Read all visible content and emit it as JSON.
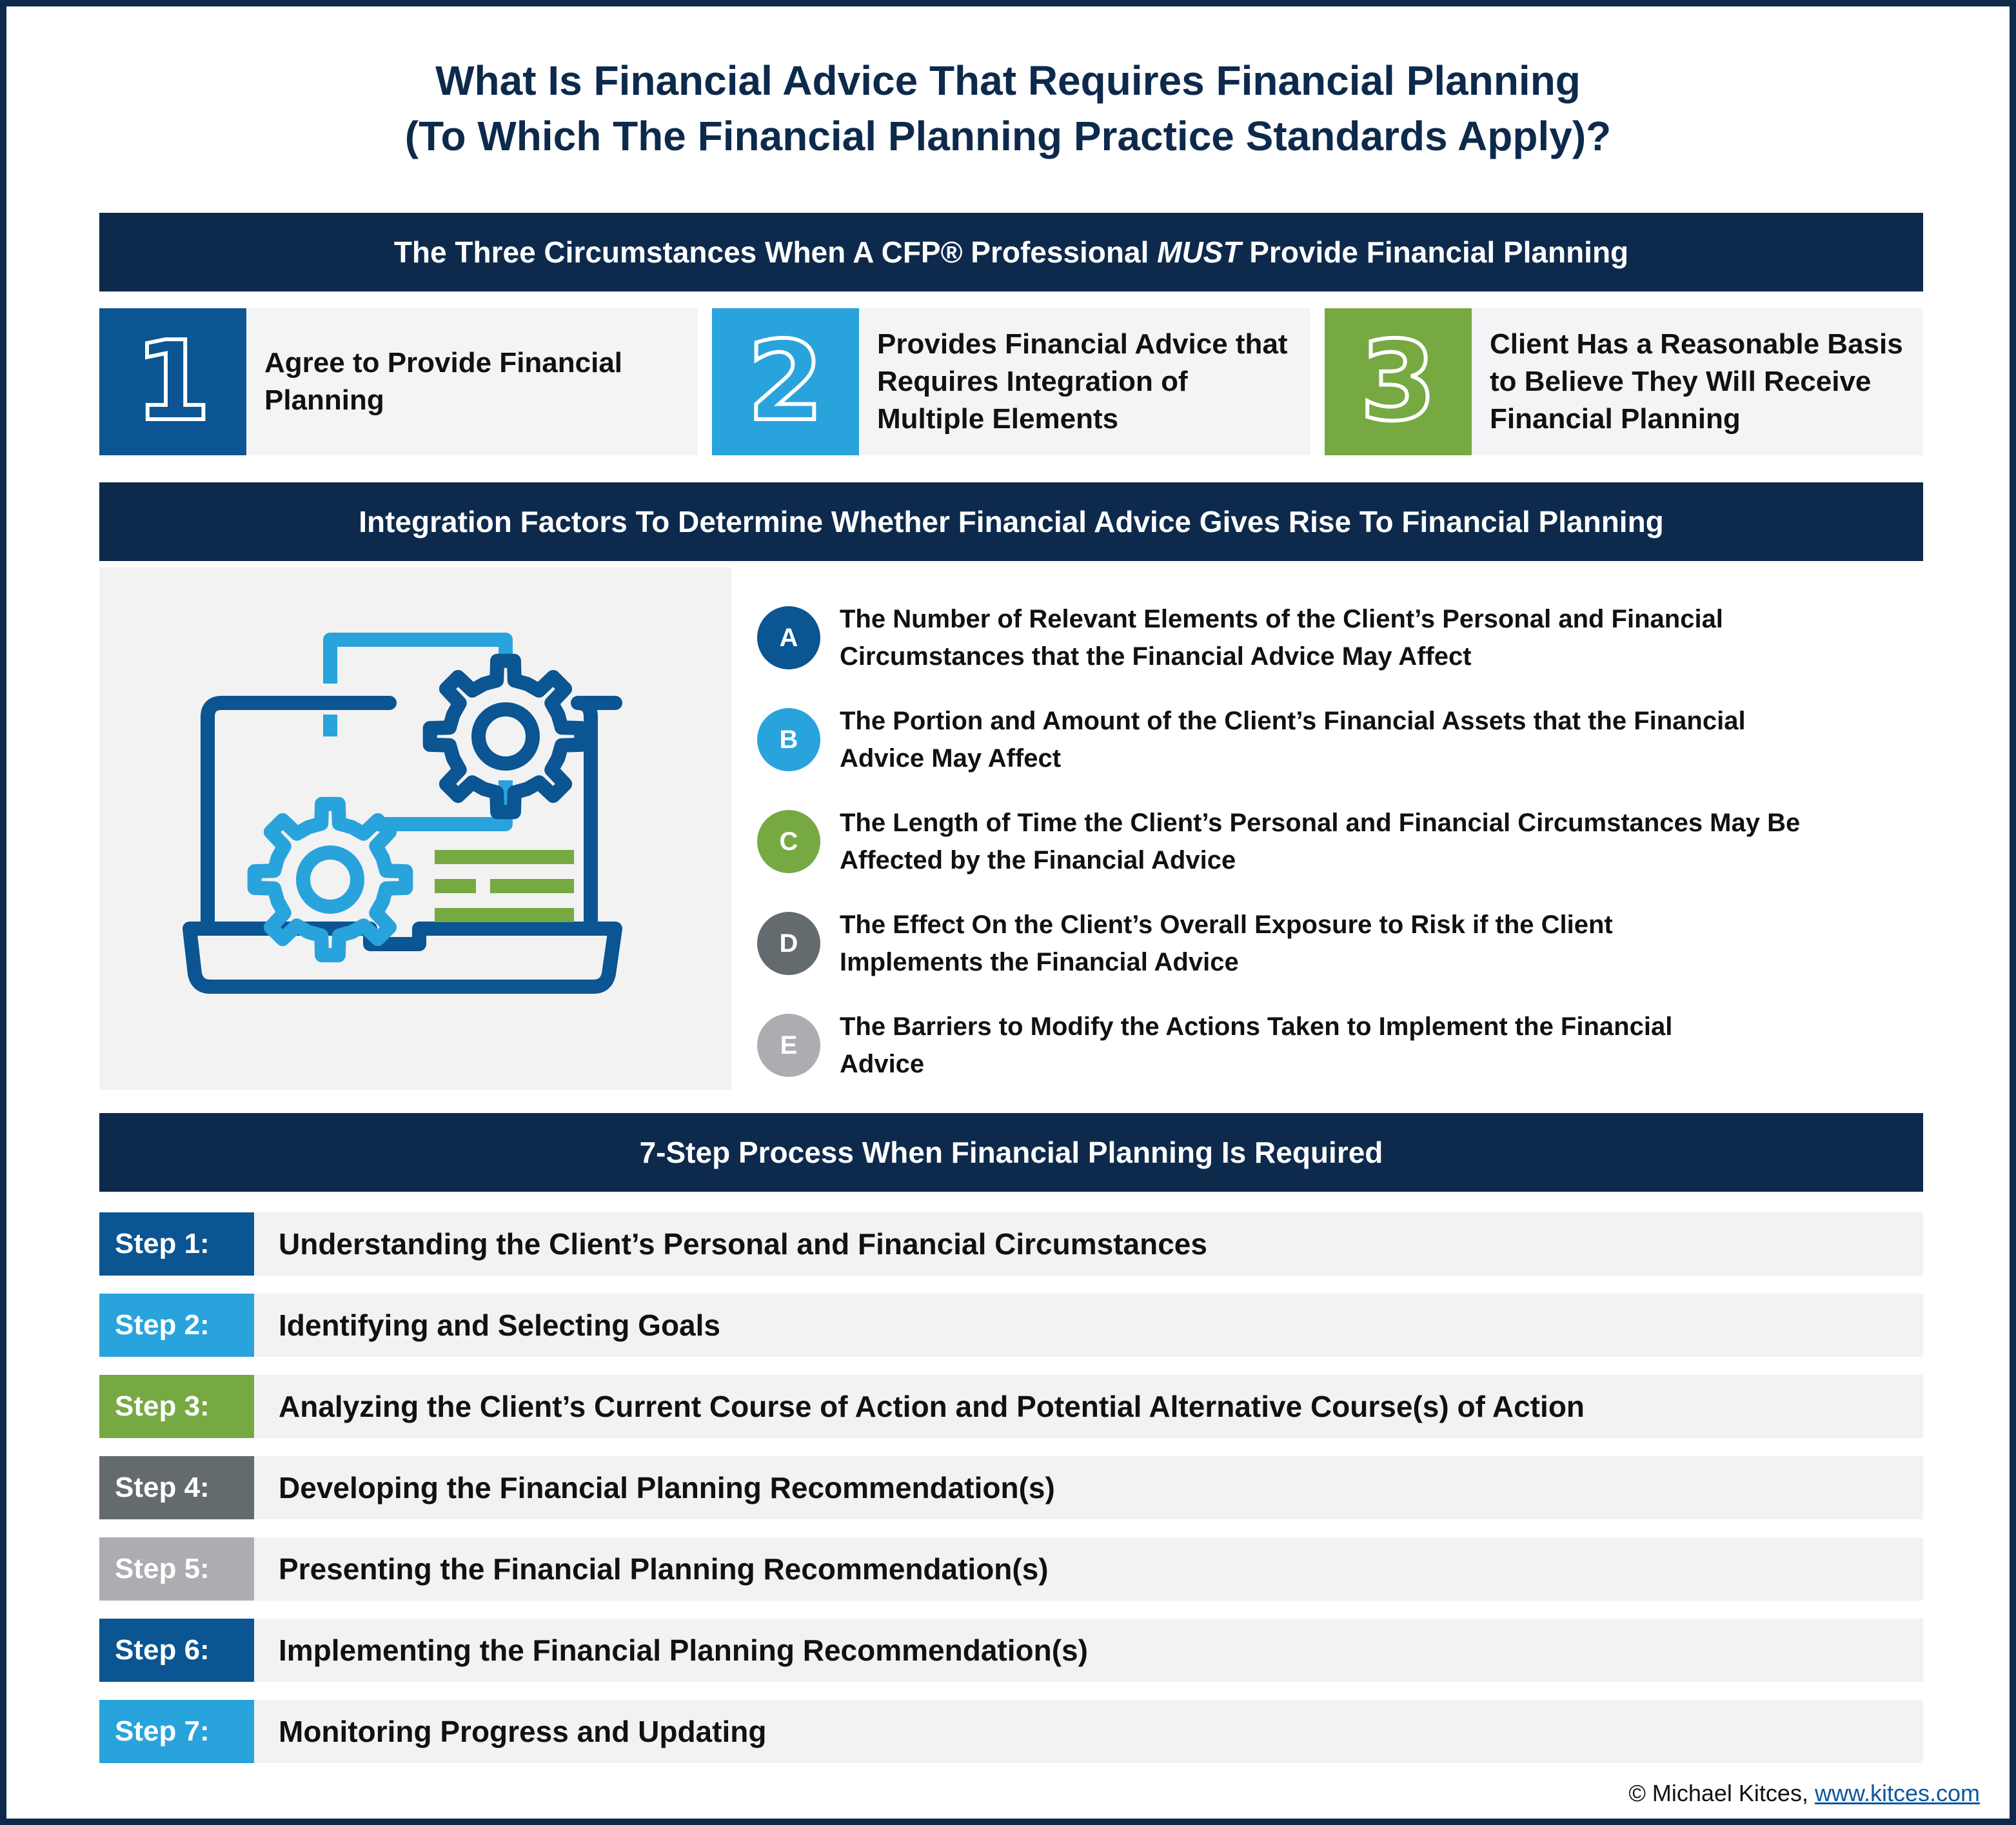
{
  "title": {
    "line1": "What Is Financial Advice That Requires Financial Planning",
    "line2": "(To Which The Financial Planning Practice Standards Apply)?"
  },
  "colors": {
    "navy": "#0d2a4d",
    "dark_blue": "#0a5592",
    "light_blue": "#29a3dc",
    "green": "#77a943",
    "dark_gray": "#646b6e",
    "light_gray": "#abadb0",
    "panel_bg": "#f2f2f2"
  },
  "circumstances": {
    "heading_pre": "The Three Circumstances When A CFP® Professional ",
    "heading_em": "MUST",
    "heading_post": " Provide Financial Planning",
    "items": [
      {
        "number": "1",
        "text": "Agree to Provide Financial Planning",
        "color": "#0a5592"
      },
      {
        "number": "2",
        "text": "Provides Financial Advice that Requires Integration of Multiple Elements",
        "color": "#29a3dc"
      },
      {
        "number": "3",
        "text": "Client Has a Reasonable Basis to Believe They Will Receive Financial Planning",
        "color": "#77a943"
      }
    ]
  },
  "factors": {
    "heading": "Integration Factors To Determine Whether Financial Advice Gives Rise To Financial Planning",
    "illustration_icon": "laptop-gears-icon",
    "items": [
      {
        "letter": "A",
        "text": "The Number of Relevant Elements of the Client’s Personal and Financial Circumstances that the Financial Advice May Affect",
        "color": "#0a5592"
      },
      {
        "letter": "B",
        "text": "The Portion and Amount of the Client’s Financial Assets that the Financial Advice May Affect",
        "color": "#29a3dc"
      },
      {
        "letter": "C",
        "text": "The Length of Time the Client’s Personal and Financial Circumstances May Be Affected by the Financial Advice",
        "color": "#77a943"
      },
      {
        "letter": "D",
        "text": "The Effect On the Client’s Overall Exposure to Risk if the Client Implements the Financial Advice",
        "color": "#646b6e"
      },
      {
        "letter": "E",
        "text": "The Barriers to Modify the Actions Taken to Implement the Financial Advice",
        "color": "#abadb0"
      }
    ]
  },
  "process": {
    "heading": "7-Step Process When Financial Planning Is Required",
    "steps": [
      {
        "label": "Step 1:",
        "text": "Understanding the Client’s Personal and Financial Circumstances",
        "color": "#0a5592"
      },
      {
        "label": "Step 2:",
        "text": "Identifying and Selecting Goals",
        "color": "#29a3dc"
      },
      {
        "label": "Step 3:",
        "text": "Analyzing the Client’s Current Course of Action and Potential Alternative Course(s) of Action",
        "color": "#77a943"
      },
      {
        "label": "Step 4:",
        "text": "Developing the Financial Planning Recommendation(s)",
        "color": "#646b6e"
      },
      {
        "label": "Step 5:",
        "text": "Presenting the Financial Planning Recommendation(s)",
        "color": "#abadb0"
      },
      {
        "label": "Step 6:",
        "text": "Implementing the Financial Planning Recommendation(s)",
        "color": "#0a5592"
      },
      {
        "label": "Step 7:",
        "text": "Monitoring Progress and Updating",
        "color": "#29a3dc"
      }
    ]
  },
  "credit": {
    "text": "© Michael Kitces, ",
    "link": "www.kitces.com"
  }
}
